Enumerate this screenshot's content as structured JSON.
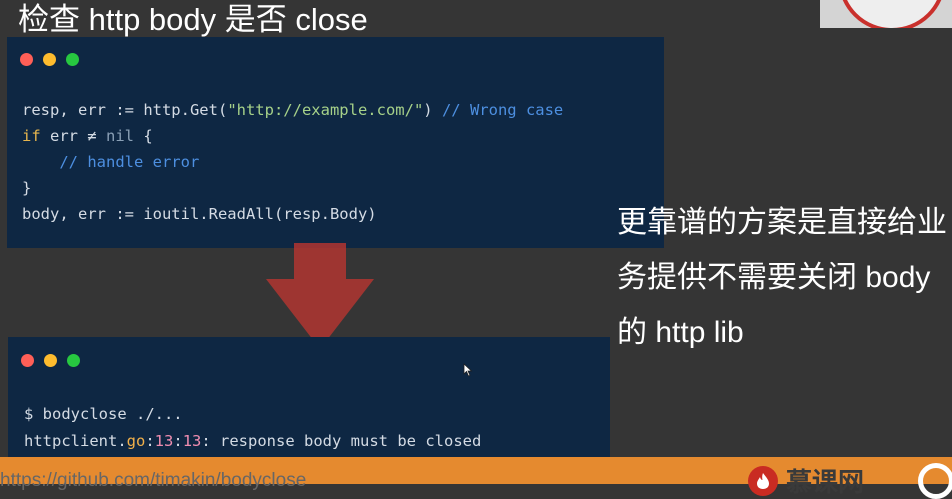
{
  "slide": {
    "title": "检查 http body 是否 close",
    "side_text": "更靠谱的方案是直接给业务提供不需要关闭 body 的 http lib",
    "url": "https://github.com/timakin/bodyclose",
    "brand_name": "慕课网"
  },
  "code_window_1": {
    "lines": [
      {
        "parts": [
          {
            "t": "resp, err := http.Get(",
            "c": ""
          },
          {
            "t": "\"http://example.com/\"",
            "c": "str"
          },
          {
            "t": ") ",
            "c": ""
          },
          {
            "t": "// Wrong case",
            "c": "cmt"
          }
        ]
      },
      {
        "parts": [
          {
            "t": "if",
            "c": "kw"
          },
          {
            "t": " err ≠ ",
            "c": ""
          },
          {
            "t": "nil",
            "c": "nil"
          },
          {
            "t": " {",
            "c": ""
          }
        ]
      },
      {
        "parts": [
          {
            "t": "    ",
            "c": ""
          },
          {
            "t": "// handle error",
            "c": "cmt"
          }
        ]
      },
      {
        "parts": [
          {
            "t": "}",
            "c": ""
          }
        ]
      },
      {
        "parts": [
          {
            "t": "body, err := ioutil.ReadAll(resp.Body)",
            "c": ""
          }
        ]
      }
    ]
  },
  "code_window_2": {
    "lines": [
      {
        "parts": [
          {
            "t": "$ bodyclose ./...",
            "c": ""
          }
        ]
      },
      {
        "parts": [
          {
            "t": "httpclient.",
            "c": ""
          },
          {
            "t": "go",
            "c": "go"
          },
          {
            "t": ":",
            "c": ""
          },
          {
            "t": "13",
            "c": "num"
          },
          {
            "t": ":",
            "c": ""
          },
          {
            "t": "13",
            "c": "num"
          },
          {
            "t": ": response body must be closed",
            "c": ""
          }
        ]
      }
    ]
  },
  "colors": {
    "background": "#353535",
    "code_bg": "#0e2743",
    "arrow": "#b03530",
    "bottom_bar": "#e58a2f",
    "brand_red": "#c92b22"
  },
  "icons": [
    "window-close-dot",
    "window-minimize-dot",
    "window-maximize-dot",
    "down-arrow",
    "mouse-cursor-icon",
    "brand-logo-icon"
  ]
}
